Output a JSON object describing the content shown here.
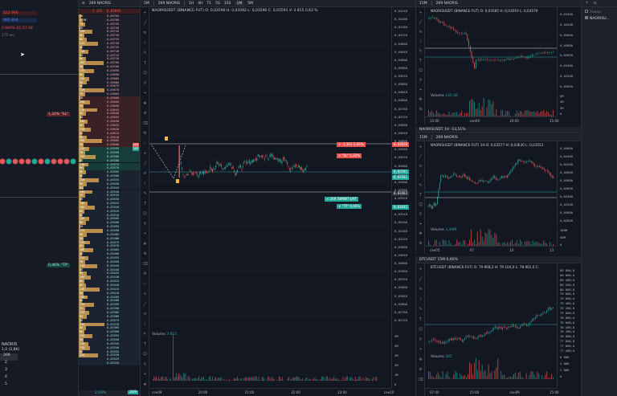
{
  "colors": {
    "bg": "#131722",
    "panel": "#1e222d",
    "up": "#26a69a",
    "down": "#ef5350",
    "accent": "#2962ff",
    "vol": "#d4a052"
  },
  "left_panel": {
    "rows": [
      {
        "text": "222 946",
        "color": "#ef5350"
      },
      {
        "text": "082 814",
        "color": "#2962ff"
      },
      {
        "text": "0,669% 01:57:28",
        "color": "#ef5350"
      },
      {
        "text": "275 мс.",
        "color": "#787b86"
      }
    ],
    "sl_label": "1,32% \"SL\"",
    "tp_label": "0,46% \"TP\"",
    "ticker_label": "NAORIS",
    "sub_label": "1,0 (2,8K)",
    "list": [
      "269",
      "2",
      "3",
      "4",
      "5"
    ]
  },
  "dom": {
    "header_tab": "269 NAORIS",
    "top_value": "1 345",
    "top_price": "0,03649",
    "prices": [
      "0,03765",
      "0,03760",
      "0,03755",
      "0,03750",
      "0,03745",
      "0,03740",
      "0,03735",
      "0,03730",
      "0,03725",
      "0,03720",
      "0,03715",
      "0,03710",
      "0,03705",
      "0,03700",
      "0,03695",
      "0,03690",
      "0,03685",
      "0,03680",
      "0,03675",
      "0,03670",
      "0,03665",
      "0,03660",
      "0,03655",
      "0,03650",
      "0,03645",
      "0,03640",
      "0,03635",
      "0,03630",
      "0,03625",
      "0,03620",
      "0,03615",
      "0,03610",
      "0,03605",
      "0,03600",
      "0,03595",
      "0,03590",
      "0,03585",
      "0,03580",
      "0,03575",
      "0,03570",
      "0,03565",
      "0,03560",
      "0,03555",
      "0,03550",
      "0,03545",
      "0,03540",
      "0,03535",
      "0,03530",
      "0,03525",
      "0,03520",
      "0,03515",
      "0,03510",
      "0,03505",
      "0,03500",
      "0,03495",
      "0,03490",
      "0,03485",
      "0,03480",
      "0,03475",
      "0,03470",
      "0,03465",
      "0,03460",
      "0,03455",
      "0,03450",
      "0,03445",
      "0,03440",
      "0,03435",
      "0,03430",
      "0,03425",
      "0,03420",
      "0,03415",
      "0,03410",
      "0,03405",
      "0,03400",
      "0,03395",
      "0,03390",
      "0,03385",
      "0,03380",
      "0,03375",
      "0,03370",
      "0,03365",
      "0,03360",
      "0,03355",
      "0,03350",
      "0,03345",
      "0,03340",
      "0,03335",
      "0,03330",
      "0,03325",
      "0,03320"
    ],
    "volumes": [
      "3K",
      "4.5K",
      "7K",
      "2K",
      "15K",
      "6K",
      "9K",
      "22K",
      "4K",
      "11K",
      "3K",
      "8K",
      "28K",
      "5K",
      "17K",
      "6K",
      "12K",
      "9K",
      "4K",
      "31K",
      "7K",
      "2K",
      "13K",
      "5K",
      "21K",
      "8K",
      "3K",
      "10K",
      "6K",
      "14K",
      "4K",
      "9K",
      "26K",
      "5K",
      "12K",
      "7K",
      "19K",
      "3K",
      "11K",
      "6K",
      "8K",
      "4K",
      "23K",
      "9K",
      "5K",
      "15K",
      "7K",
      "3K",
      "10K",
      "18K",
      "6K",
      "4K",
      "12K",
      "8K",
      "2K",
      "27K",
      "9K",
      "5K",
      "13K",
      "6K",
      "16K",
      "4K",
      "11K",
      "7K",
      "21K",
      "3K",
      "9K",
      "14K",
      "6K",
      "8K",
      "24K",
      "5K",
      "10K",
      "4K",
      "17K",
      "7K",
      "12K",
      "9K",
      "3K",
      "29K",
      "8K",
      "6K",
      "15K",
      "5K",
      "11K",
      "13K",
      "4K",
      "22K"
    ],
    "bottom_value": "2,69%",
    "bottom_right": "269",
    "best_ask_badge": "269",
    "best_bid_badge": "269"
  },
  "main_chart": {
    "toolbar": [
      "1M",
      "269 NAORIS",
      "1H",
      "4H",
      "T1",
      "5S",
      "15S",
      "1M",
      "5M"
    ],
    "title": "NAORISUSDT (BINANCE-FUT) O: 0,03590  H: 0,03592  L: 0,03590  C: 0,03591  V: 3 815  0,63 %",
    "y_ticks": [
      "0,04240",
      "0,04200",
      "0,04160",
      "0,04120",
      "0,04080",
      "0,04040",
      "0,04000",
      "0,03960",
      "0,03920",
      "0,03880",
      "0,03840",
      "0,03800",
      "0,03760",
      "0,03720",
      "0,03680",
      "0,03640",
      "0,03600",
      "0,03560",
      "0,03520",
      "0,03480",
      "0,03440",
      "0,03400",
      "0,03360",
      "0,03320",
      "0,03280",
      "0,03240",
      "0,03200",
      "0,03160",
      "0,03120",
      "0,03080",
      "0,03040",
      "0,03000",
      "0,02960",
      "0,02920",
      "0,02880",
      "0,02840",
      "0,02800",
      "0,02760",
      "0,02720"
    ],
    "vol_ticks": [
      "5M",
      "4M",
      "3M",
      "2M",
      "1M",
      "0"
    ],
    "x_ticks": [
      "сен09",
      "20:00",
      "21:00",
      "22:00",
      "23:00",
      "сен10"
    ],
    "order_tags": [
      {
        "text": "× -1 361  2,69%",
        "bg": "#ef5350"
      },
      {
        "text": "× \"SL\"  1,32%",
        "bg": "#ef5350"
      },
      {
        "text": "× 269   ЛИМИТ-LMT",
        "bg": "#26a69a"
      },
      {
        "text": "× \"TP\"  0,46%",
        "bg": "#26a69a"
      }
    ],
    "price_badges": [
      "0,03650",
      "0,03591",
      "0,03561",
      "0,03463",
      "0,03445"
    ],
    "volume_label": "Volume",
    "volume_value": "3 815"
  },
  "chart_a": {
    "toolbar": [
      "15M",
      "269 NAORIS"
    ],
    "title": "NAORISUSDT (BINANCE-FUT) O: 0,03585  H: 0,03593  L: 0,03579",
    "y_ticks": [
      "0,04400",
      "0,04200",
      "0,04000",
      "0,03800",
      "0,03600",
      "0,03400",
      "0,03200",
      "0,03000"
    ],
    "vol_ticks": [
      "6M",
      "4M",
      "2M",
      "0"
    ],
    "x_ticks": [
      "15:00",
      "сен09",
      "20:00",
      "15:00"
    ],
    "volume_label": "Volume",
    "volume_value": "135,6K",
    "badges": [
      "0,03591",
      "0,03561"
    ]
  },
  "chart_b": {
    "tab": "NAORISUSDT 1H -13,51%",
    "toolbar": [
      "15M",
      "269 NAORIS"
    ],
    "title": "NAORISUSDT (BINANCE-FUT) 1H O: 0,03577  H: 0,03630  L: 0,03551",
    "y_ticks": [
      "0,04600",
      "0,04400",
      "0,04200",
      "0,04000",
      "0,03800",
      "0,03600",
      "0,03400",
      "0,03200",
      "0,03000",
      "0,02800"
    ],
    "vol_ticks": [
      "100M",
      "50M",
      "0"
    ],
    "x_ticks": [
      "сен05",
      "07",
      "10",
      "13"
    ],
    "volume_label": "Volume",
    "volume_value": "3,44M",
    "badges": [
      "0,03591",
      "0,03561"
    ]
  },
  "chart_c": {
    "tab": "BTCUSDT 15M 0,60%",
    "title": "BTCUSDT (BINANCE-FUT) O: 79 968,2  H: 79 104,0  L: 78 901,0  C:",
    "y_ticks": [
      "80 800,0",
      "80 600,0",
      "80 400,0",
      "80 200,0",
      "80 000,0",
      "79 800,0",
      "79 600,0",
      "79 400,0",
      "79 200,0",
      "79 000,0",
      "78 800,0",
      "78 600,0",
      "78 400,0",
      "78 200,0",
      "78 000,0",
      "77 800,0",
      "77 600,0",
      "77 400,0"
    ],
    "vol_ticks": [
      "6 000",
      "4 000",
      "2 000",
      "0"
    ],
    "x_ticks": [
      "07:00",
      "15:00",
      "сен09",
      "15:00"
    ],
    "volume_label": "Volume",
    "volume_value": "285"
  },
  "right_sidebar": {
    "items": [
      "Тикер",
      "NAORISU..."
    ]
  }
}
